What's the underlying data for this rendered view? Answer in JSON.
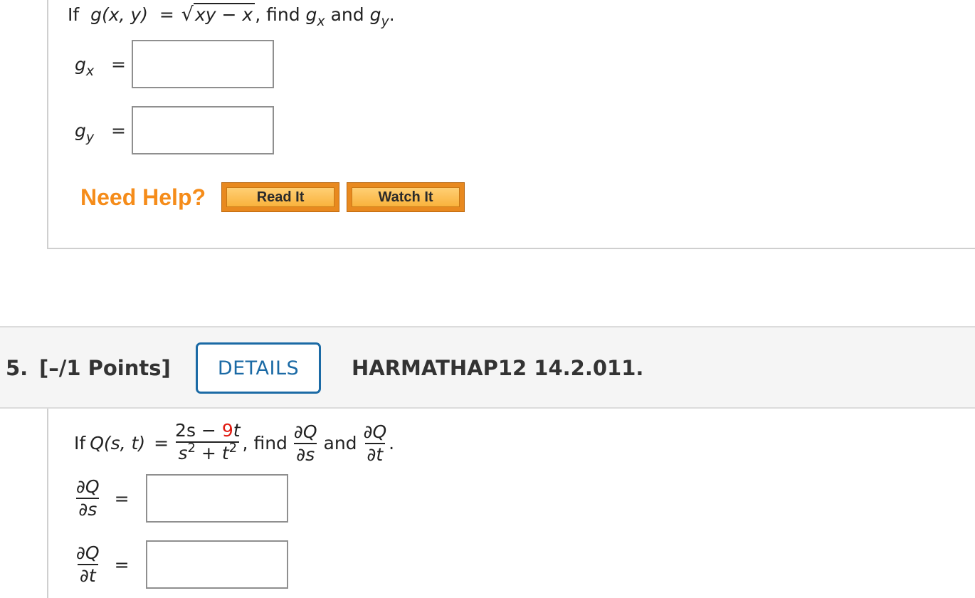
{
  "q4": {
    "prompt": {
      "if": "If",
      "func": "g(x, y)",
      "equals": "=",
      "radicand": "xy − x",
      "find": ", find",
      "gx_base": "g",
      "gx_sub": "x",
      "and": "and",
      "gy_base": "g",
      "gy_sub": "y",
      "period": "."
    },
    "answers": [
      {
        "base": "g",
        "sub": "x",
        "equals": "=",
        "value": ""
      },
      {
        "base": "g",
        "sub": "y",
        "equals": "=",
        "value": ""
      }
    ],
    "help": {
      "label": "Need Help?",
      "read_it": "Read It",
      "watch_it": "Watch It"
    }
  },
  "q5": {
    "header": {
      "number": "5.",
      "points": "[–/1 Points]",
      "details": "DETAILS",
      "code": "HARMATHAP12 14.2.011."
    },
    "prompt": {
      "if": "If",
      "func": "Q(s, t)",
      "equals": "=",
      "num_left": "2s −",
      "num_red": "9",
      "num_right": "t",
      "den_s": "s",
      "den_sup1": "2",
      "den_plus": "+",
      "den_t": "t",
      "den_sup2": "2",
      "find": ", find",
      "d_num": "∂Q",
      "ds_den": "∂s",
      "and": "and",
      "dt_den": "∂t",
      "period": "."
    },
    "answers": [
      {
        "num": "∂Q",
        "den": "∂s",
        "equals": "=",
        "value": ""
      },
      {
        "num": "∂Q",
        "den": "∂t",
        "equals": "=",
        "value": ""
      }
    ]
  },
  "colors": {
    "need_help": "#f58c1a",
    "button_orange": "#e8891f",
    "details_blue": "#1b6aa5",
    "coefficient_red": "#e0190f"
  }
}
